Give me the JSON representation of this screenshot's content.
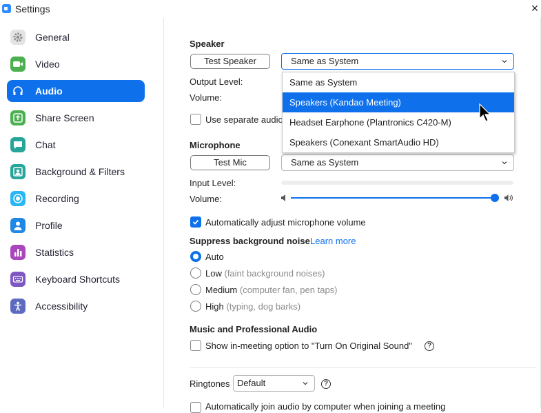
{
  "window": {
    "title": "Settings",
    "close_glyph": "×"
  },
  "sidebar": {
    "items": [
      {
        "label": "General",
        "icon": "gear-icon",
        "color": "#9e9e9e",
        "active": false
      },
      {
        "label": "Video",
        "icon": "video-camera-icon",
        "color": "#4caf50",
        "active": false
      },
      {
        "label": "Audio",
        "icon": "headphones-icon",
        "color": "#0e71eb",
        "active": true
      },
      {
        "label": "Share Screen",
        "icon": "share-screen-icon",
        "color": "#4caf50",
        "active": false
      },
      {
        "label": "Chat",
        "icon": "chat-bubble-icon",
        "color": "#26a69a",
        "active": false
      },
      {
        "label": "Background & Filters",
        "icon": "person-frame-icon",
        "color": "#26a69a",
        "active": false
      },
      {
        "label": "Recording",
        "icon": "record-icon",
        "color": "#29b6f6",
        "active": false
      },
      {
        "label": "Profile",
        "icon": "person-icon",
        "color": "#1e88e5",
        "active": false
      },
      {
        "label": "Statistics",
        "icon": "bar-chart-icon",
        "color": "#ab47bc",
        "active": false
      },
      {
        "label": "Keyboard Shortcuts",
        "icon": "keyboard-icon",
        "color": "#7e57c2",
        "active": false
      },
      {
        "label": "Accessibility",
        "icon": "accessibility-icon",
        "color": "#5c6bc0",
        "active": false
      }
    ]
  },
  "speaker": {
    "title": "Speaker",
    "test_button": "Test Speaker",
    "device_selected": "Same as System",
    "output_level_label": "Output Level:",
    "volume_label": "Volume:",
    "separate_audio_label": "Use separate audio",
    "dropdown_options": [
      "Same as System",
      "Speakers (Kandao Meeting)",
      "Headset Earphone (Plantronics C420-M)",
      "Speakers (Conexant SmartAudio HD)"
    ],
    "highlighted_option_index": 1
  },
  "microphone": {
    "title": "Microphone",
    "test_button": "Test Mic",
    "device_selected": "Same as System",
    "input_level_label": "Input Level:",
    "volume_label": "Volume:",
    "volume_level_fraction": 1.0,
    "auto_adjust_label": "Automatically adjust microphone volume",
    "auto_adjust_checked": true
  },
  "noise": {
    "title": "Suppress background noise",
    "learn_more": "Learn more",
    "options": [
      {
        "label": "Auto",
        "hint": "",
        "checked": true
      },
      {
        "label": "Low",
        "hint": "(faint background noises)",
        "checked": false
      },
      {
        "label": "Medium",
        "hint": "(computer fan, pen taps)",
        "checked": false
      },
      {
        "label": "High",
        "hint": "(typing, dog barks)",
        "checked": false
      }
    ]
  },
  "music": {
    "title": "Music and Professional Audio",
    "original_sound_label": "Show in-meeting option to \"Turn On Original Sound\"",
    "help_glyph": "?"
  },
  "ringtones": {
    "label": "Ringtones",
    "selected": "Default",
    "help_glyph": "?"
  },
  "join_audio": {
    "label": "Automatically join audio by computer when joining a meeting"
  },
  "colors": {
    "accent": "#0e71eb",
    "hint_text": "#8a8a8a"
  }
}
